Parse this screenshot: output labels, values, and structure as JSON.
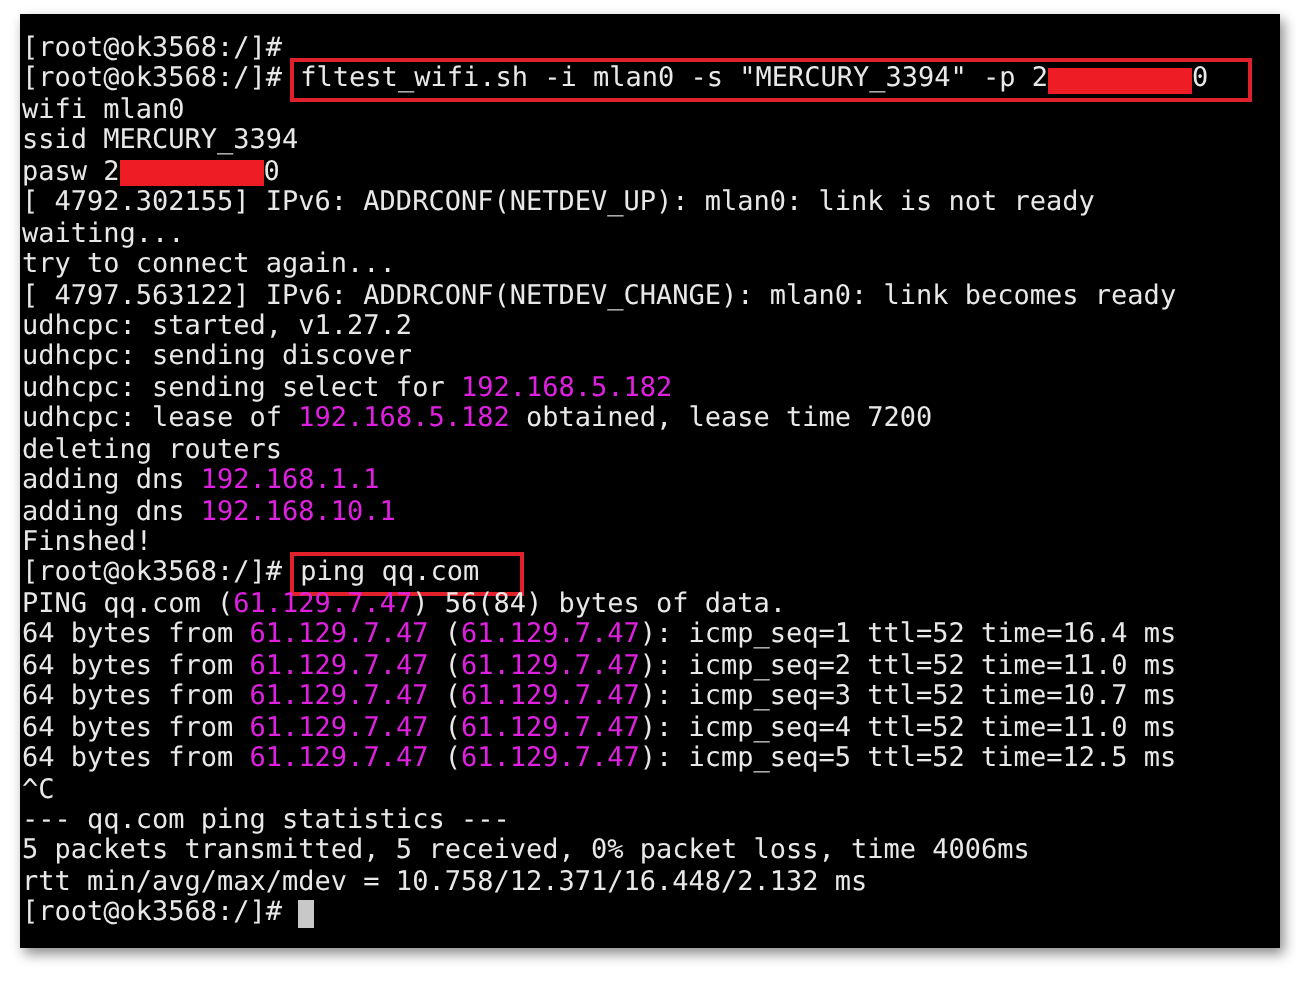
{
  "terminal": {
    "lines": [
      {
        "parts": [
          {
            "kind": "text",
            "text": "[root@ok3568:/]#"
          }
        ]
      },
      {
        "parts": [
          {
            "kind": "text",
            "text": "[root@ok3568:/]# "
          },
          {
            "kind": "highlight",
            "parts": [
              {
                "kind": "text",
                "text": "fltest_wifi.sh -i mlan0 -s \"MERCURY_3394\" -p 2"
              },
              {
                "kind": "redacted"
              },
              {
                "kind": "text",
                "text": "0"
              }
            ]
          }
        ]
      },
      {
        "parts": [
          {
            "kind": "text",
            "text": "wifi mlan0"
          }
        ]
      },
      {
        "parts": [
          {
            "kind": "text",
            "text": "ssid MERCURY_3394"
          }
        ]
      },
      {
        "parts": [
          {
            "kind": "text",
            "text": "pasw 2"
          },
          {
            "kind": "redacted"
          },
          {
            "kind": "text",
            "text": "0"
          }
        ]
      },
      {
        "parts": [
          {
            "kind": "text",
            "text": "[ 4792.302155] IPv6: ADDRCONF(NETDEV_UP): mlan0: link is not ready"
          }
        ]
      },
      {
        "parts": [
          {
            "kind": "text",
            "text": "waiting..."
          }
        ]
      },
      {
        "parts": [
          {
            "kind": "text",
            "text": "try to connect again..."
          }
        ]
      },
      {
        "parts": [
          {
            "kind": "text",
            "text": "[ 4797.563122] IPv6: ADDRCONF(NETDEV_CHANGE): mlan0: link becomes ready"
          }
        ]
      },
      {
        "parts": [
          {
            "kind": "text",
            "text": "udhcpc: started, v1.27.2"
          }
        ]
      },
      {
        "parts": [
          {
            "kind": "text",
            "text": "udhcpc: sending discover"
          }
        ]
      },
      {
        "parts": [
          {
            "kind": "text",
            "text": "udhcpc: sending select for "
          },
          {
            "kind": "ip",
            "text": "192.168.5.182"
          }
        ]
      },
      {
        "parts": [
          {
            "kind": "text",
            "text": "udhcpc: lease of "
          },
          {
            "kind": "ip",
            "text": "192.168.5.182"
          },
          {
            "kind": "text",
            "text": " obtained, lease time 7200"
          }
        ]
      },
      {
        "parts": [
          {
            "kind": "text",
            "text": "deleting routers"
          }
        ]
      },
      {
        "parts": [
          {
            "kind": "text",
            "text": "adding dns "
          },
          {
            "kind": "ip",
            "text": "192.168.1.1"
          }
        ]
      },
      {
        "parts": [
          {
            "kind": "text",
            "text": "adding dns "
          },
          {
            "kind": "ip",
            "text": "192.168.10.1"
          }
        ]
      },
      {
        "parts": [
          {
            "kind": "text",
            "text": "Finshed!"
          }
        ]
      },
      {
        "parts": [
          {
            "kind": "text",
            "text": "[root@ok3568:/]# "
          },
          {
            "kind": "highlight",
            "parts": [
              {
                "kind": "text",
                "text": "ping qq.com"
              }
            ]
          }
        ]
      },
      {
        "parts": [
          {
            "kind": "text",
            "text": "PING qq.com ("
          },
          {
            "kind": "ip",
            "text": "61.129.7.47"
          },
          {
            "kind": "text",
            "text": ") 56(84) bytes of data."
          }
        ]
      },
      {
        "parts": [
          {
            "kind": "text",
            "text": "64 bytes from "
          },
          {
            "kind": "ip",
            "text": "61.129.7.47"
          },
          {
            "kind": "text",
            "text": " ("
          },
          {
            "kind": "ip",
            "text": "61.129.7.47"
          },
          {
            "kind": "text",
            "text": "): icmp_seq=1 ttl=52 time=16.4 ms"
          }
        ]
      },
      {
        "parts": [
          {
            "kind": "text",
            "text": "64 bytes from "
          },
          {
            "kind": "ip",
            "text": "61.129.7.47"
          },
          {
            "kind": "text",
            "text": " ("
          },
          {
            "kind": "ip",
            "text": "61.129.7.47"
          },
          {
            "kind": "text",
            "text": "): icmp_seq=2 ttl=52 time=11.0 ms"
          }
        ]
      },
      {
        "parts": [
          {
            "kind": "text",
            "text": "64 bytes from "
          },
          {
            "kind": "ip",
            "text": "61.129.7.47"
          },
          {
            "kind": "text",
            "text": " ("
          },
          {
            "kind": "ip",
            "text": "61.129.7.47"
          },
          {
            "kind": "text",
            "text": "): icmp_seq=3 ttl=52 time=10.7 ms"
          }
        ]
      },
      {
        "parts": [
          {
            "kind": "text",
            "text": "64 bytes from "
          },
          {
            "kind": "ip",
            "text": "61.129.7.47"
          },
          {
            "kind": "text",
            "text": " ("
          },
          {
            "kind": "ip",
            "text": "61.129.7.47"
          },
          {
            "kind": "text",
            "text": "): icmp_seq=4 ttl=52 time=11.0 ms"
          }
        ]
      },
      {
        "parts": [
          {
            "kind": "text",
            "text": "64 bytes from "
          },
          {
            "kind": "ip",
            "text": "61.129.7.47"
          },
          {
            "kind": "text",
            "text": " ("
          },
          {
            "kind": "ip",
            "text": "61.129.7.47"
          },
          {
            "kind": "text",
            "text": "): icmp_seq=5 ttl=52 time=12.5 ms"
          }
        ]
      },
      {
        "parts": [
          {
            "kind": "text",
            "text": "^C"
          }
        ]
      },
      {
        "parts": [
          {
            "kind": "text",
            "text": "--- qq.com ping statistics ---"
          }
        ]
      },
      {
        "parts": [
          {
            "kind": "text",
            "text": "5 packets transmitted, 5 received, 0% packet loss, time 4006ms"
          }
        ]
      },
      {
        "parts": [
          {
            "kind": "text",
            "text": "rtt min/avg/max/mdev = 10.758/12.371/16.448/2.132 ms"
          }
        ]
      },
      {
        "parts": [
          {
            "kind": "text",
            "text": "[root@ok3568:/]# "
          },
          {
            "kind": "cursor"
          }
        ]
      }
    ]
  }
}
